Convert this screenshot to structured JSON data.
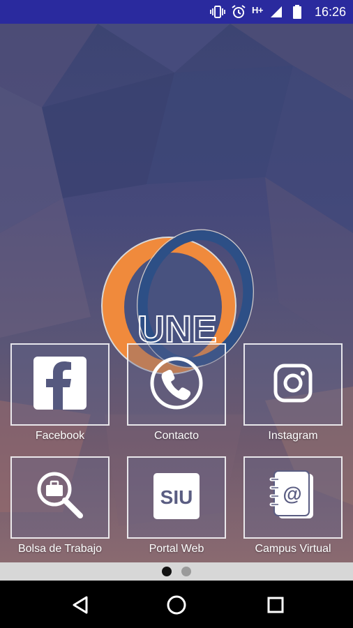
{
  "status_bar": {
    "time": "16:26",
    "network": "H+",
    "icons": [
      "vibrate-icon",
      "alarm-icon",
      "signal-icon",
      "battery-icon"
    ]
  },
  "logo": {
    "text": "UNE"
  },
  "shortcuts": [
    {
      "label": "Facebook",
      "icon": "facebook-icon"
    },
    {
      "label": "Contacto",
      "icon": "phone-icon"
    },
    {
      "label": "Instagram",
      "icon": "instagram-icon"
    },
    {
      "label": "Bolsa de Trabajo",
      "icon": "job-search-icon"
    },
    {
      "label": "Portal Web",
      "icon": "siu-icon"
    },
    {
      "label": "Campus Virtual",
      "icon": "address-book-icon"
    }
  ],
  "siu_text": "SIU",
  "pager": {
    "pages": 2,
    "current": 1
  },
  "nav_bar": {
    "buttons": [
      "back-icon",
      "home-icon",
      "recents-icon"
    ]
  },
  "colors": {
    "status_bar": "#2a2a9e",
    "logo_orange": "#f08a3c",
    "logo_blue": "#2d4f86"
  }
}
